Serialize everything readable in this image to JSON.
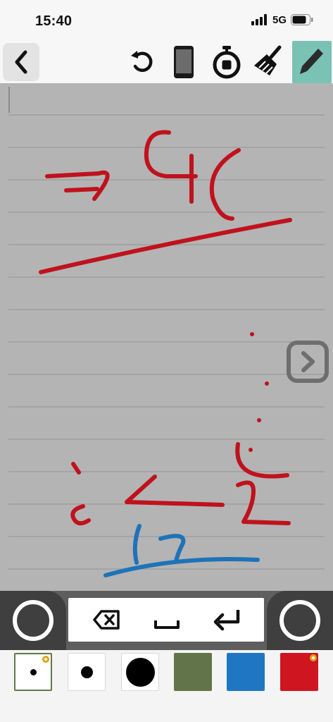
{
  "status_bar": {
    "time": "15:40",
    "network": "5G",
    "icons": [
      "signal-bars-icon",
      "battery-icon"
    ]
  },
  "toolbar": {
    "items": [
      {
        "icon": "back-chevron-icon"
      },
      {
        "icon": "undo-icon"
      },
      {
        "icon": "phone-icon"
      },
      {
        "icon": "stopwatch-icon"
      },
      {
        "icon": "broom-icon"
      },
      {
        "icon": "pencil-icon",
        "selected": true
      }
    ]
  },
  "canvas": {
    "background": "#b4b4b4",
    "rule_color": "#9a9a9a",
    "ink_colors": [
      "#c0121d",
      "#1e73b8"
    ]
  },
  "keyboard": {
    "keys": [
      "backspace-icon",
      "space-icon",
      "return-icon"
    ],
    "side_buttons": [
      "left-ring-icon",
      "right-ring-icon"
    ]
  },
  "palette": {
    "swatches": [
      {
        "kind": "small-dot",
        "color": "#000000",
        "selected": true
      },
      {
        "kind": "medium-dot",
        "color": "#000000"
      },
      {
        "kind": "large-dot",
        "color": "#000000"
      },
      {
        "kind": "color",
        "color": "#627449"
      },
      {
        "kind": "color",
        "color": "#1f77c4"
      },
      {
        "kind": "color",
        "color": "#cf1520",
        "selected_badge": true
      }
    ]
  }
}
